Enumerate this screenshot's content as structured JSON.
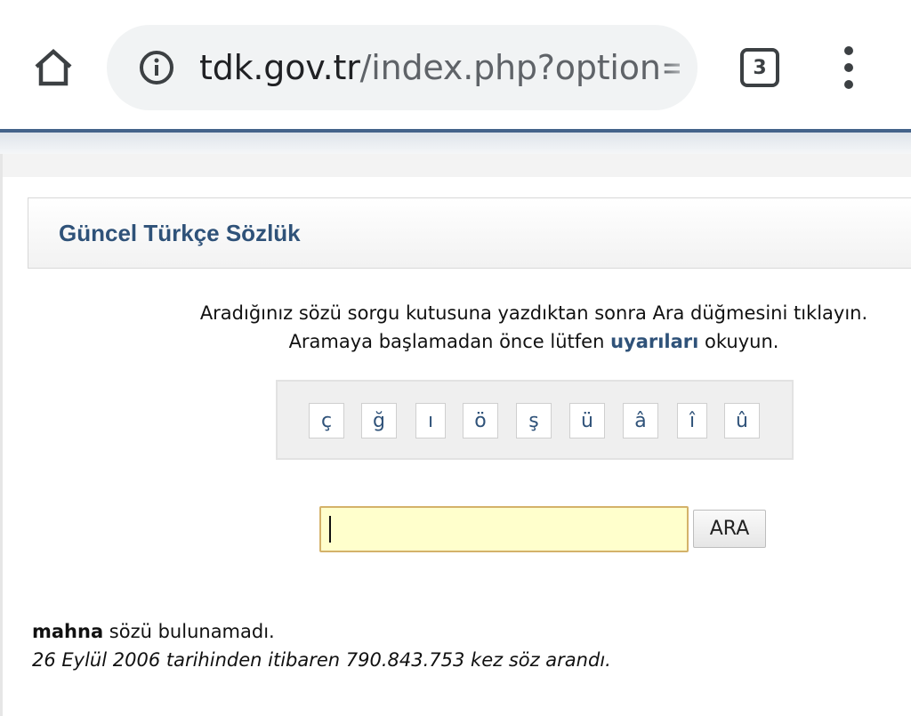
{
  "browser": {
    "url_domain": "tdk.gov.tr",
    "url_path": "/index.php?option=co",
    "tab_count": "3",
    "icons": {
      "home": "home-icon",
      "info": "info-icon",
      "tabs": "tab-switcher-icon",
      "menu": "more-vert-icon"
    }
  },
  "panel": {
    "title": "Güncel Türkçe Sözlük"
  },
  "instructions": {
    "line1": "Aradığınız sözü sorgu kutusuna yazdıktan sonra Ara düğmesini tıklayın.",
    "line2_before": "Aramaya başlamadan önce lütfen ",
    "line2_link": "uyarıları",
    "line2_after": " okuyun."
  },
  "special_chars": [
    "ç",
    "ğ",
    "ı",
    "ö",
    "ş",
    "ü",
    "â",
    "î",
    "û"
  ],
  "search": {
    "value": "",
    "button_label": "ARA"
  },
  "result": {
    "word": "mahna",
    "message": " sözü bulunamadı.",
    "stats": "26 Eylül 2006 tarihinden itibaren 790.843.753 kez söz arandı."
  },
  "colors": {
    "link_blue": "#2f5279",
    "input_bg": "#ffffcc",
    "input_border": "#d4b26a",
    "top_bar": "#44638a"
  }
}
